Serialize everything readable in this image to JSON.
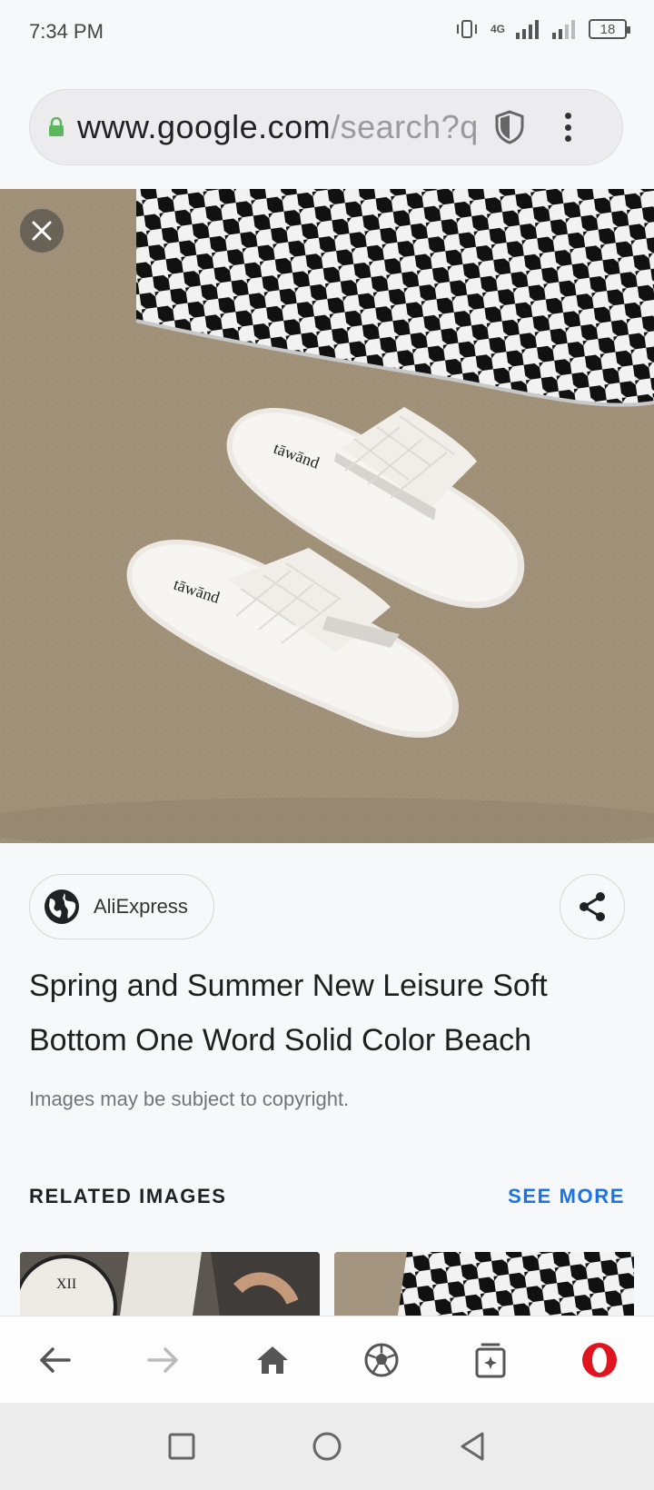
{
  "status_bar": {
    "time": "7:34 PM",
    "network": "4G",
    "battery": "18"
  },
  "url_bar": {
    "domain": "www.google.com",
    "path": "/search?q",
    "icons": [
      "lock-icon",
      "shield-icon",
      "kebab-menu-icon"
    ]
  },
  "viewer": {
    "close_icon": "close-icon",
    "brand_mark": "tāwānd"
  },
  "source": {
    "label": "AliExpress",
    "icon": "globe-icon"
  },
  "share_icon": "share-icon",
  "title": "Spring and Summer New Leisure Soft Bottom One Word Solid Color Beach",
  "copyright": "Images may be subject to copyright.",
  "related": {
    "heading": "RELATED IMAGES",
    "see_more": "SEE MORE"
  },
  "browser_toolbar": {
    "items": [
      "back-icon",
      "forward-icon",
      "home-icon",
      "soccer-ball-icon",
      "tab-switcher-icon",
      "opera-logo-icon"
    ]
  },
  "system_nav": {
    "items": [
      "recents-icon",
      "home-circle-icon",
      "back-triangle-icon"
    ]
  },
  "colors": {
    "accent": "#1a73e8",
    "opera_red": "#e0141e",
    "lock_green": "#5bb75b"
  }
}
